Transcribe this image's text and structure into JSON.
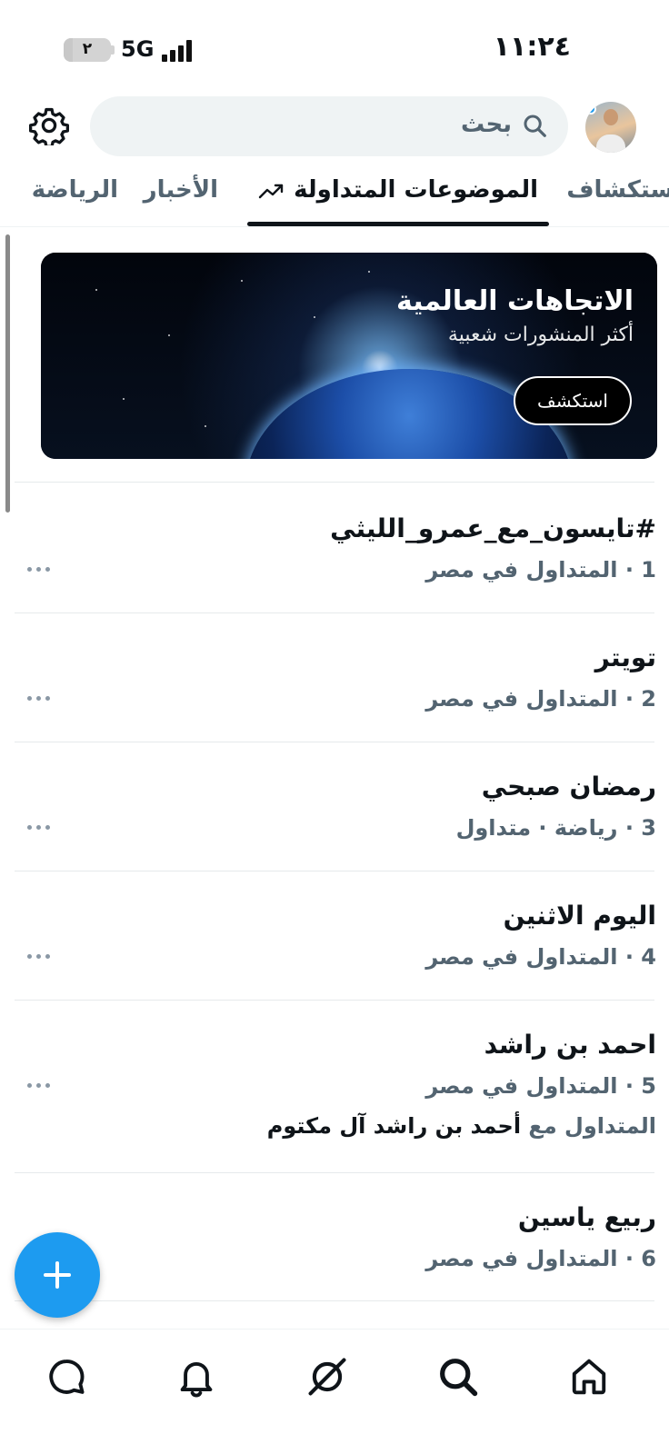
{
  "status_bar": {
    "time": "١١:٢٤",
    "network": "5G",
    "battery_level": "٢",
    "battery_fraction": 0.2
  },
  "header": {
    "search_placeholder": "بحث",
    "settings_icon": "gear-icon",
    "avatar_icon": "user-avatar"
  },
  "tabs": [
    {
      "label": "استكشاف",
      "active": false
    },
    {
      "label": "الموضوعات المتداولة",
      "active": true,
      "icon": "trending-icon"
    },
    {
      "label": "الأخبار",
      "active": false
    },
    {
      "label": "الرياضة",
      "active": false
    }
  ],
  "banner": {
    "title": "الاتجاهات العالمية",
    "subtitle": "أكثر المنشورات شعبية",
    "cta_label": "استكشف"
  },
  "trends": [
    {
      "name": "#تايسون_مع_عمرو_الليثي",
      "meta": "1 · المتداول في مصر"
    },
    {
      "name": "تويتر",
      "meta": "2 · المتداول في مصر"
    },
    {
      "name": "رمضان صبحي",
      "meta": "3 · رياضة · متداول"
    },
    {
      "name": "اليوم الاثنين",
      "meta": "4 · المتداول في مصر"
    },
    {
      "name": "احمد بن راشد",
      "meta": "5 · المتداول في مصر",
      "context_prefix": "المتداول مع",
      "context_name": "أحمد بن راشد آل مكتوم"
    },
    {
      "name": "ربيع ياسين",
      "meta": "6 · المتداول في مصر"
    }
  ],
  "fab": {
    "icon": "plus-icon"
  },
  "bottom_nav": [
    {
      "icon": "messages-icon"
    },
    {
      "icon": "notifications-icon"
    },
    {
      "icon": "grok-icon"
    },
    {
      "icon": "search-icon"
    },
    {
      "icon": "home-icon"
    }
  ],
  "colors": {
    "accent": "#1d9bf0",
    "text_primary": "#0f1419",
    "text_secondary": "#536471",
    "divider": "#e6eaec"
  }
}
